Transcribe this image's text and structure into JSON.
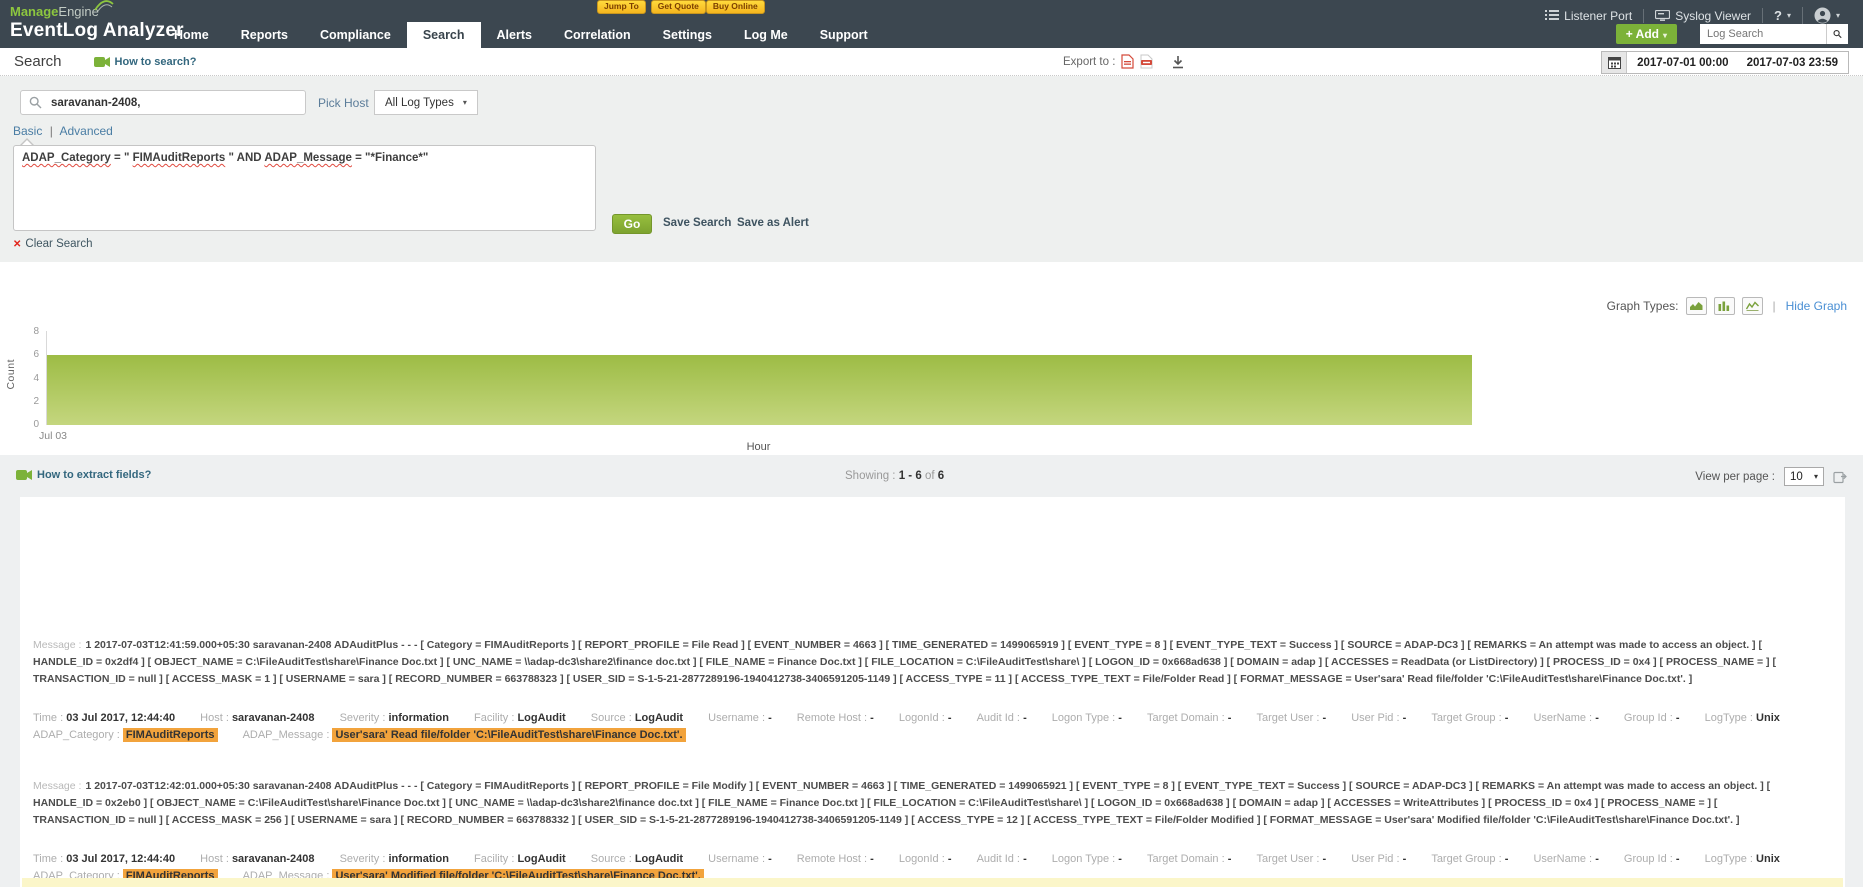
{
  "colors": {
    "topbar_bg": "#3c4750",
    "brand_green": "#8dc63f",
    "button_green": "#7cb239",
    "promo_yellow": "#f5b51e",
    "highlight_orange": "#f2a33c",
    "link_blue": "#4a8fd4",
    "area_green_top": "#9dbc45",
    "area_green_bottom": "#c4d67e"
  },
  "topbar": {
    "brand_bold": "Manage",
    "brand_rest": "Engine",
    "brand_product": "EventLog Analyzer",
    "promo": [
      {
        "label": "Jump To"
      },
      {
        "label": "Get Quote"
      },
      {
        "label": "Buy Online"
      }
    ],
    "listener_port": "Listener Port",
    "syslog_viewer": "Syslog Viewer",
    "help": "?",
    "add_button": "+ Add",
    "log_search_placeholder": "Log Search",
    "nav": [
      {
        "label": "Home",
        "cls": ""
      },
      {
        "label": "Reports",
        "cls": ""
      },
      {
        "label": "Compliance",
        "cls": ""
      },
      {
        "label": "Search",
        "cls": "active"
      },
      {
        "label": "Alerts",
        "cls": ""
      },
      {
        "label": "Correlation",
        "cls": ""
      },
      {
        "label": "Settings",
        "cls": ""
      },
      {
        "label": "Log Me",
        "cls": ""
      },
      {
        "label": "Support",
        "cls": ""
      }
    ]
  },
  "page_header": {
    "title": "Search",
    "how_to_search": "How to search?",
    "export_label": "Export to :",
    "date_from": "2017-07-01 00:00",
    "date_to": "2017-07-03 23:59"
  },
  "search_form": {
    "query_input_value": "saravanan-2408,",
    "pick_host_label": "Pick Host",
    "log_types_dropdown": "All Log Types",
    "mode_basic": "Basic",
    "mode_sep": "|",
    "mode_advanced": "Advanced",
    "query_parts": [
      {
        "text": "ADAP_Category",
        "cls": "sq"
      },
      {
        "text": " = \"",
        "cls": ""
      },
      {
        "text": "FIMAuditReports",
        "cls": "sq"
      },
      {
        "text": "\" AND ",
        "cls": ""
      },
      {
        "text": "ADAP_Message",
        "cls": "sq"
      },
      {
        "text": " = \"*Finance*\"",
        "cls": ""
      }
    ],
    "go_button": "Go",
    "save_search": "Save Search",
    "save_as_alert": "Save as Alert",
    "clear_search": "Clear Search"
  },
  "graph": {
    "graph_types_label": "Graph Types:",
    "separator": "|",
    "hide_graph": "Hide Graph",
    "type_icons": [
      "area-chart",
      "bar-chart",
      "line-chart"
    ]
  },
  "chart_data": {
    "type": "area",
    "title": "",
    "xlabel": "Hour",
    "ylabel": "Count",
    "x_ticks": [
      "Jul 03"
    ],
    "y_ticks": [
      "8",
      "6",
      "4",
      "2",
      "0"
    ],
    "ylim": [
      0,
      8
    ],
    "series": [
      {
        "name": "Count",
        "values": [
          6
        ]
      }
    ],
    "note_layout": {
      "legend": false,
      "grid": false,
      "area_extends_partial_width": true
    }
  },
  "results": {
    "how_to_extract": "How to extract fields?",
    "showing_label": "Showing :",
    "showing_range": "1 - 6",
    "showing_of": "of",
    "showing_total": "6",
    "view_per_page_label": "View per page :",
    "view_per_page_value": "10",
    "records": [
      {
        "message_label": "Message :",
        "message": "1 2017-07-03T12:41:59.000+05:30 saravanan-2408 ADAuditPlus - - - [ Category = FIMAuditReports ] [ REPORT_PROFILE = File Read ] [ EVENT_NUMBER = 4663 ] [ TIME_GENERATED = 1499065919 ] [ EVENT_TYPE = 8 ] [ EVENT_TYPE_TEXT = Success ] [ SOURCE = ADAP-DC3 ] [ REMARKS = An attempt was made to access an object. ] [ HANDLE_ID = 0x2df4 ] [ OBJECT_NAME = C:\\FileAuditTest\\share\\Finance Doc.txt ] [ UNC_NAME = \\\\adap-dc3\\share2\\finance doc.txt ] [ FILE_NAME = Finance Doc.txt ] [ FILE_LOCATION = C:\\FileAuditTest\\share\\ ] [ LOGON_ID = 0x668ad638 ] [ DOMAIN = adap ] [ ACCESSES = ReadData (or ListDirectory) ] [ PROCESS_ID = 0x4 ] [ PROCESS_NAME = ] [ TRANSACTION_ID = null ] [ ACCESS_MASK = 1 ] [ USERNAME = sara ] [ RECORD_NUMBER = 663788323 ] [ USER_SID = S-1-5-21-2877289196-1940412738-3406591205-1149 ] [ ACCESS_TYPE = 11 ] [ ACCESS_TYPE_TEXT = File/Folder Read ] [ FORMAT_MESSAGE = User'sara' Read file/folder 'C:\\FileAuditTest\\share\\Finance Doc.txt'. ]",
        "fields": [
          {
            "label": "Time :",
            "value": "03 Jul 2017, 12:44:40",
            "cls": ""
          },
          {
            "label": "Host :",
            "value": "saravanan-2408",
            "cls": ""
          },
          {
            "label": "Severity :",
            "value": "information",
            "cls": ""
          },
          {
            "label": "Facility :",
            "value": "LogAudit",
            "cls": ""
          },
          {
            "label": "Source :",
            "value": "LogAudit",
            "cls": ""
          },
          {
            "label": "Username :",
            "value": "-",
            "cls": ""
          },
          {
            "label": "Remote Host :",
            "value": "-",
            "cls": ""
          },
          {
            "label": "LogonId :",
            "value": "-",
            "cls": ""
          },
          {
            "label": "Audit Id :",
            "value": "-",
            "cls": ""
          },
          {
            "label": "Logon Type :",
            "value": "-",
            "cls": ""
          },
          {
            "label": "Target Domain :",
            "value": "-",
            "cls": ""
          },
          {
            "label": "Target User :",
            "value": "-",
            "cls": ""
          },
          {
            "label": "User Pid :",
            "value": "-",
            "cls": ""
          },
          {
            "label": "Target Group :",
            "value": "-",
            "cls": ""
          },
          {
            "label": "UserName :",
            "value": "-",
            "cls": ""
          },
          {
            "label": "Group Id :",
            "value": "-",
            "cls": ""
          },
          {
            "label": "LogType :",
            "value": "Unix",
            "cls": ""
          },
          {
            "label": "ADAP_Category :",
            "value": "FIMAuditReports",
            "cls": "hl"
          },
          {
            "label": "ADAP_Message :",
            "value": "User'sara' Read file/folder 'C:\\FileAuditTest\\share\\Finance Doc.txt'.",
            "cls": "hl"
          }
        ]
      },
      {
        "message_label": "Message :",
        "message": "1 2017-07-03T12:42:01.000+05:30 saravanan-2408 ADAuditPlus - - - [ Category = FIMAuditReports ] [ REPORT_PROFILE = File Modify ] [ EVENT_NUMBER = 4663 ] [ TIME_GENERATED = 1499065921 ] [ EVENT_TYPE = 8 ] [ EVENT_TYPE_TEXT = Success ] [ SOURCE = ADAP-DC3 ] [ REMARKS = An attempt was made to access an object. ] [ HANDLE_ID = 0x2eb0 ] [ OBJECT_NAME = C:\\FileAuditTest\\share\\Finance Doc.txt ] [ UNC_NAME = \\\\adap-dc3\\share2\\finance doc.txt ] [ FILE_NAME = Finance Doc.txt ] [ FILE_LOCATION = C:\\FileAuditTest\\share\\ ] [ LOGON_ID = 0x668ad638 ] [ DOMAIN = adap ] [ ACCESSES = WriteAttributes ] [ PROCESS_ID = 0x4 ] [ PROCESS_NAME = ] [ TRANSACTION_ID = null ] [ ACCESS_MASK = 256 ] [ USERNAME = sara ] [ RECORD_NUMBER = 663788332 ] [ USER_SID = S-1-5-21-2877289196-1940412738-3406591205-1149 ] [ ACCESS_TYPE = 12 ] [ ACCESS_TYPE_TEXT = File/Folder Modified ] [ FORMAT_MESSAGE = User'sara' Modified file/folder 'C:\\FileAuditTest\\share\\Finance Doc.txt'. ]",
        "fields": [
          {
            "label": "Time :",
            "value": "03 Jul 2017, 12:44:40",
            "cls": ""
          },
          {
            "label": "Host :",
            "value": "saravanan-2408",
            "cls": ""
          },
          {
            "label": "Severity :",
            "value": "information",
            "cls": ""
          },
          {
            "label": "Facility :",
            "value": "LogAudit",
            "cls": ""
          },
          {
            "label": "Source :",
            "value": "LogAudit",
            "cls": ""
          },
          {
            "label": "Username :",
            "value": "-",
            "cls": ""
          },
          {
            "label": "Remote Host :",
            "value": "-",
            "cls": ""
          },
          {
            "label": "LogonId :",
            "value": "-",
            "cls": ""
          },
          {
            "label": "Audit Id :",
            "value": "-",
            "cls": ""
          },
          {
            "label": "Logon Type :",
            "value": "-",
            "cls": ""
          },
          {
            "label": "Target Domain :",
            "value": "-",
            "cls": ""
          },
          {
            "label": "Target User :",
            "value": "-",
            "cls": ""
          },
          {
            "label": "User Pid :",
            "value": "-",
            "cls": ""
          },
          {
            "label": "Target Group :",
            "value": "-",
            "cls": ""
          },
          {
            "label": "UserName :",
            "value": "-",
            "cls": ""
          },
          {
            "label": "Group Id :",
            "value": "-",
            "cls": ""
          },
          {
            "label": "LogType :",
            "value": "Unix",
            "cls": ""
          },
          {
            "label": "ADAP_Category :",
            "value": "FIMAuditReports",
            "cls": "hl"
          },
          {
            "label": "ADAP_Message :",
            "value": "User'sara' Modified file/folder 'C:\\FileAuditTest\\share\\Finance Doc.txt'.",
            "cls": "hl"
          }
        ]
      }
    ]
  }
}
